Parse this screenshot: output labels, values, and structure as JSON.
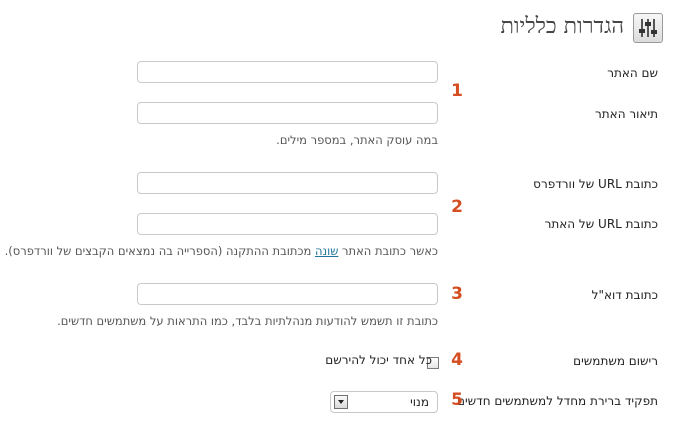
{
  "header": {
    "title": "הגדרות כלליות",
    "icon": "settings-sliders-icon"
  },
  "fields": {
    "site_name": {
      "label": "שם האתר",
      "value": "",
      "marker": "1"
    },
    "site_description": {
      "label": "תיאור האתר",
      "value": "",
      "description": "במה עוסק האתר, במספר מילים."
    },
    "wordpress_url": {
      "label": "כתובת URL של וורדפרס",
      "value": "",
      "marker": "2"
    },
    "site_url": {
      "label": "כתובת URL של האתר",
      "value": "",
      "description_before": "כאשר כתובת האתר ",
      "description_link": "שונה",
      "description_after": " מכתובת ההתקנה (הספרייה בה נמצאים הקבצים של וורדפרס)."
    },
    "email": {
      "label": "כתובת דוא\"ל",
      "value": "",
      "marker": "3",
      "description": "כתובת זו תשמש להודעות מנהלתיות בלבד, כמו התראות על משתמשים חדשים."
    },
    "membership": {
      "label": "רישום משתמשים",
      "checkbox_label": "כל אחד יכול להירשם",
      "checked": false,
      "marker": "4"
    },
    "default_role": {
      "label": "תפקיד ברירת מחדל למשתמשים חדשים",
      "selected": "מנוי",
      "marker": "5"
    }
  },
  "colors": {
    "marker": "#d54e21",
    "link": "#21759b"
  }
}
